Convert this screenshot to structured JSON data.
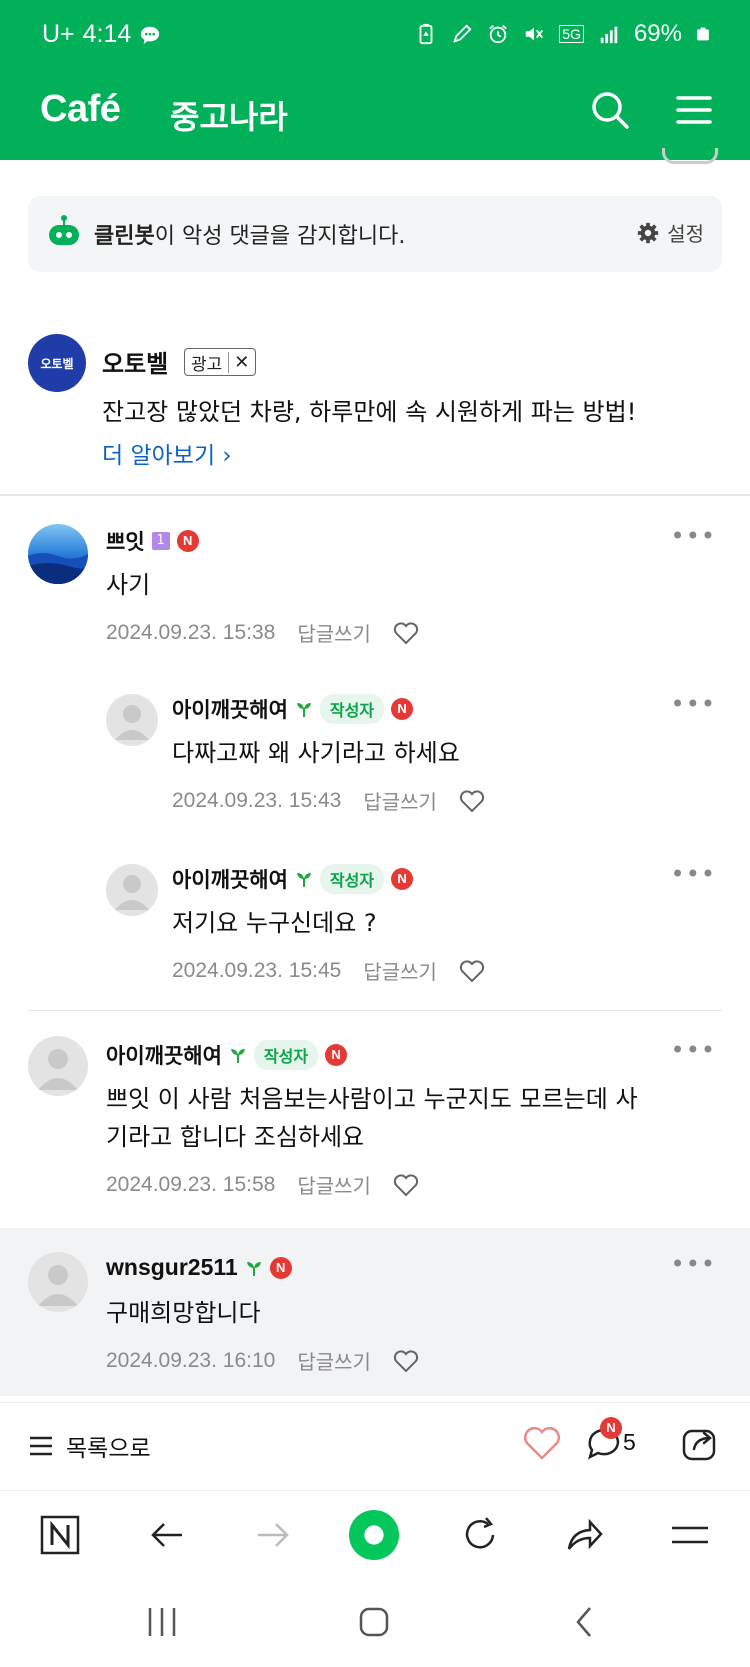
{
  "status_bar": {
    "carrier": "U+",
    "time": "4:14",
    "network": "5G",
    "battery": "69%"
  },
  "header": {
    "logo": "Café",
    "cafe_name": "중고나라"
  },
  "cleanbot": {
    "name": "클린봇",
    "message": "이 악성 댓글을 감지합니다.",
    "settings_label": "설정"
  },
  "ad": {
    "logo_text": "오토벨",
    "advertiser": "오토벨",
    "badge": "광고",
    "close": "✕",
    "text": "잔고장 많았던 차량, 하루만에 속 시원하게 파는 방법!",
    "link": "더 알아보기 ›"
  },
  "comments": [
    {
      "nick": "쁘잇",
      "level": "1",
      "text": "사기",
      "date": "2024.09.23. 15:38",
      "reply": "답글쓰기",
      "new_badge": "N"
    },
    {
      "nick": "아이깨끗해여",
      "author_tag": "작성자",
      "text": "다짜고짜 왜 사기라고 하세요",
      "date": "2024.09.23. 15:43",
      "reply": "답글쓰기",
      "new_badge": "N"
    },
    {
      "nick": "아이깨끗해여",
      "author_tag": "작성자",
      "text": "저기요 누구신데요 ?",
      "date": "2024.09.23. 15:45",
      "reply": "답글쓰기",
      "new_badge": "N"
    },
    {
      "nick": "아이깨끗해여",
      "author_tag": "작성자",
      "text_line1": "쁘잇 이 사람 처음보는사람이고 누군지도 모르는데 사",
      "text_line2": "기라고 합니다 조심하세요",
      "date": "2024.09.23. 15:58",
      "reply": "답글쓰기",
      "new_badge": "N"
    },
    {
      "nick": "wnsgur2511",
      "text": "구매희망합니다",
      "date": "2024.09.23. 16:10",
      "reply": "답글쓰기",
      "new_badge": "N"
    }
  ],
  "list_bar": {
    "list_label": "목록으로",
    "comment_count": "5",
    "comment_new_badge": "N"
  },
  "colors": {
    "brand_green": "#03b05a",
    "link_blue": "#0d63c4",
    "new_badge_red": "#e53935",
    "author_tag_green": "#0aa34a"
  }
}
